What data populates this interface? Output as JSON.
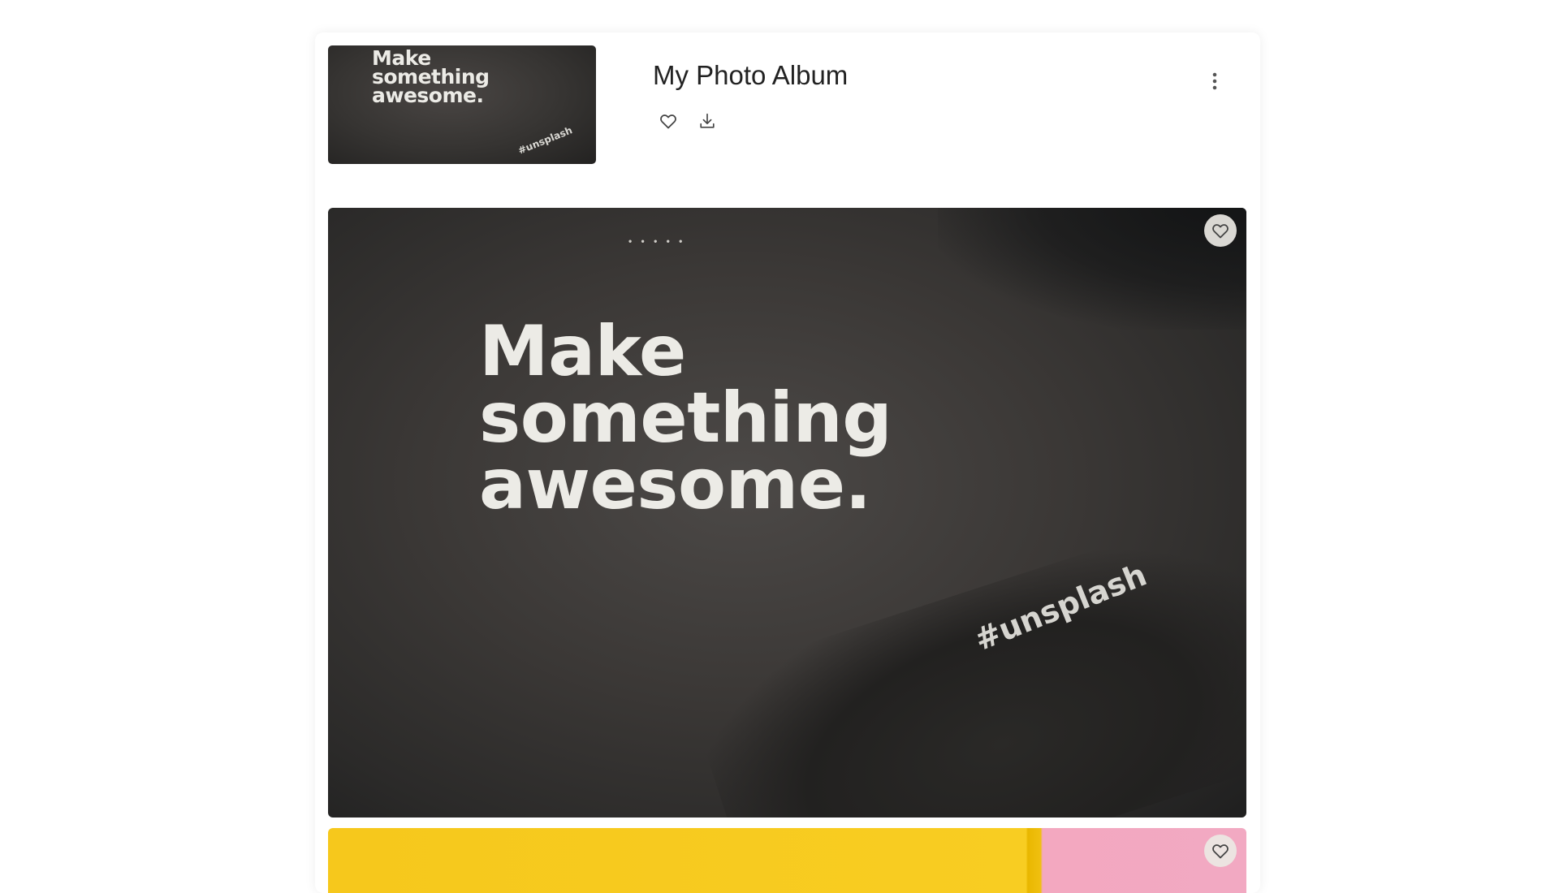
{
  "album": {
    "title": "My Photo Album",
    "cover_text": "Make\nsomething\nawesome.",
    "cover_tag": "#unsplash"
  },
  "actions": {
    "like_icon": "heart-outline-icon",
    "download_icon": "download-icon",
    "menu_icon": "more-vertical-icon"
  },
  "photos": [
    {
      "shirt_text": "Make\nsomething\nawesome.",
      "sleeve_tag": "#unsplash",
      "collar_text": "• • • • •",
      "favorite_icon": "heart-outline-icon"
    },
    {
      "favorite_icon": "heart-outline-icon",
      "colors": [
        "#f8cd22",
        "#f2a9c2"
      ]
    }
  ]
}
